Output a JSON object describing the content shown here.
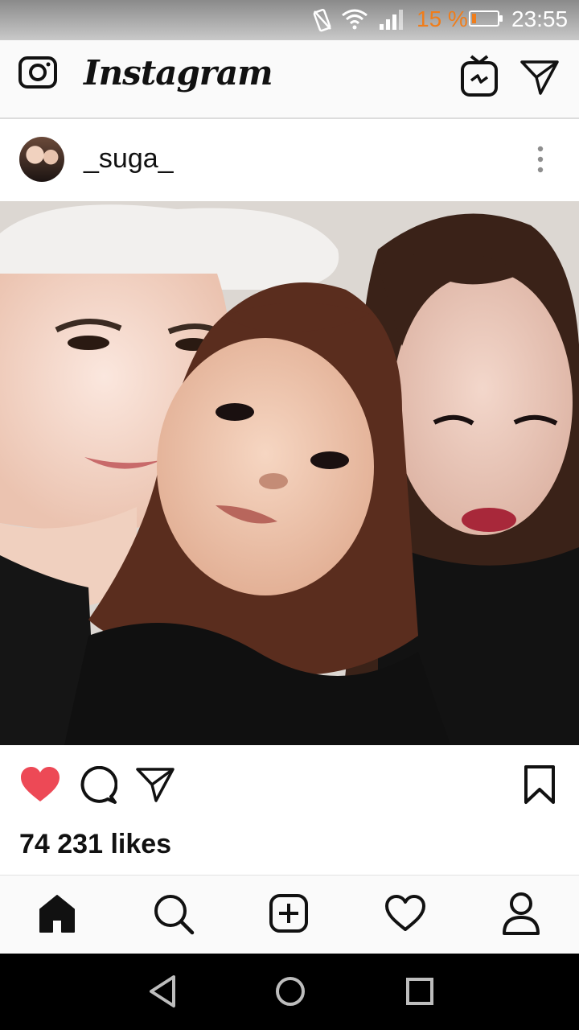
{
  "status_bar": {
    "battery_percent": "15 %",
    "battery_level": 0.15,
    "time": "23:55"
  },
  "header": {
    "app_title": "Instagram"
  },
  "post": {
    "username": "_suga_",
    "likes_text": "74 231 likes",
    "liked": true
  },
  "colors": {
    "like_red": "#ed4956",
    "battery_orange": "#f07d1a"
  },
  "icons": {
    "camera": "camera-icon",
    "igtv": "igtv-icon",
    "direct": "send-icon",
    "more": "more-vertical-icon",
    "like": "heart-filled-icon",
    "comment": "comment-icon",
    "share": "send-icon",
    "save": "bookmark-icon",
    "nav": [
      "home-icon",
      "search-icon",
      "add-post-icon",
      "activity-heart-icon",
      "profile-icon"
    ]
  }
}
